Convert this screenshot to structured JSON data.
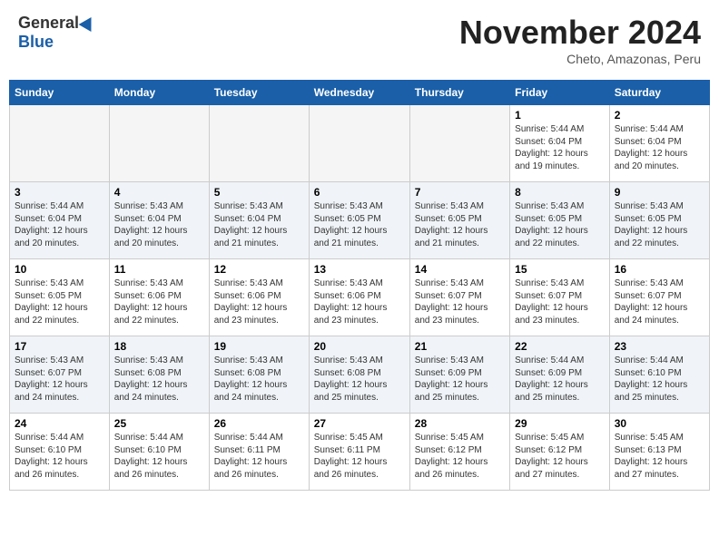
{
  "header": {
    "logo": {
      "general": "General",
      "blue": "Blue"
    },
    "title": "November 2024",
    "location": "Cheto, Amazonas, Peru"
  },
  "calendar": {
    "days_of_week": [
      "Sunday",
      "Monday",
      "Tuesday",
      "Wednesday",
      "Thursday",
      "Friday",
      "Saturday"
    ],
    "weeks": [
      [
        {
          "day": "",
          "info": ""
        },
        {
          "day": "",
          "info": ""
        },
        {
          "day": "",
          "info": ""
        },
        {
          "day": "",
          "info": ""
        },
        {
          "day": "",
          "info": ""
        },
        {
          "day": "1",
          "info": "Sunrise: 5:44 AM\nSunset: 6:04 PM\nDaylight: 12 hours\nand 19 minutes."
        },
        {
          "day": "2",
          "info": "Sunrise: 5:44 AM\nSunset: 6:04 PM\nDaylight: 12 hours\nand 20 minutes."
        }
      ],
      [
        {
          "day": "3",
          "info": "Sunrise: 5:44 AM\nSunset: 6:04 PM\nDaylight: 12 hours\nand 20 minutes."
        },
        {
          "day": "4",
          "info": "Sunrise: 5:43 AM\nSunset: 6:04 PM\nDaylight: 12 hours\nand 20 minutes."
        },
        {
          "day": "5",
          "info": "Sunrise: 5:43 AM\nSunset: 6:04 PM\nDaylight: 12 hours\nand 21 minutes."
        },
        {
          "day": "6",
          "info": "Sunrise: 5:43 AM\nSunset: 6:05 PM\nDaylight: 12 hours\nand 21 minutes."
        },
        {
          "day": "7",
          "info": "Sunrise: 5:43 AM\nSunset: 6:05 PM\nDaylight: 12 hours\nand 21 minutes."
        },
        {
          "day": "8",
          "info": "Sunrise: 5:43 AM\nSunset: 6:05 PM\nDaylight: 12 hours\nand 22 minutes."
        },
        {
          "day": "9",
          "info": "Sunrise: 5:43 AM\nSunset: 6:05 PM\nDaylight: 12 hours\nand 22 minutes."
        }
      ],
      [
        {
          "day": "10",
          "info": "Sunrise: 5:43 AM\nSunset: 6:05 PM\nDaylight: 12 hours\nand 22 minutes."
        },
        {
          "day": "11",
          "info": "Sunrise: 5:43 AM\nSunset: 6:06 PM\nDaylight: 12 hours\nand 22 minutes."
        },
        {
          "day": "12",
          "info": "Sunrise: 5:43 AM\nSunset: 6:06 PM\nDaylight: 12 hours\nand 23 minutes."
        },
        {
          "day": "13",
          "info": "Sunrise: 5:43 AM\nSunset: 6:06 PM\nDaylight: 12 hours\nand 23 minutes."
        },
        {
          "day": "14",
          "info": "Sunrise: 5:43 AM\nSunset: 6:07 PM\nDaylight: 12 hours\nand 23 minutes."
        },
        {
          "day": "15",
          "info": "Sunrise: 5:43 AM\nSunset: 6:07 PM\nDaylight: 12 hours\nand 23 minutes."
        },
        {
          "day": "16",
          "info": "Sunrise: 5:43 AM\nSunset: 6:07 PM\nDaylight: 12 hours\nand 24 minutes."
        }
      ],
      [
        {
          "day": "17",
          "info": "Sunrise: 5:43 AM\nSunset: 6:07 PM\nDaylight: 12 hours\nand 24 minutes."
        },
        {
          "day": "18",
          "info": "Sunrise: 5:43 AM\nSunset: 6:08 PM\nDaylight: 12 hours\nand 24 minutes."
        },
        {
          "day": "19",
          "info": "Sunrise: 5:43 AM\nSunset: 6:08 PM\nDaylight: 12 hours\nand 24 minutes."
        },
        {
          "day": "20",
          "info": "Sunrise: 5:43 AM\nSunset: 6:08 PM\nDaylight: 12 hours\nand 25 minutes."
        },
        {
          "day": "21",
          "info": "Sunrise: 5:43 AM\nSunset: 6:09 PM\nDaylight: 12 hours\nand 25 minutes."
        },
        {
          "day": "22",
          "info": "Sunrise: 5:44 AM\nSunset: 6:09 PM\nDaylight: 12 hours\nand 25 minutes."
        },
        {
          "day": "23",
          "info": "Sunrise: 5:44 AM\nSunset: 6:10 PM\nDaylight: 12 hours\nand 25 minutes."
        }
      ],
      [
        {
          "day": "24",
          "info": "Sunrise: 5:44 AM\nSunset: 6:10 PM\nDaylight: 12 hours\nand 26 minutes."
        },
        {
          "day": "25",
          "info": "Sunrise: 5:44 AM\nSunset: 6:10 PM\nDaylight: 12 hours\nand 26 minutes."
        },
        {
          "day": "26",
          "info": "Sunrise: 5:44 AM\nSunset: 6:11 PM\nDaylight: 12 hours\nand 26 minutes."
        },
        {
          "day": "27",
          "info": "Sunrise: 5:45 AM\nSunset: 6:11 PM\nDaylight: 12 hours\nand 26 minutes."
        },
        {
          "day": "28",
          "info": "Sunrise: 5:45 AM\nSunset: 6:12 PM\nDaylight: 12 hours\nand 26 minutes."
        },
        {
          "day": "29",
          "info": "Sunrise: 5:45 AM\nSunset: 6:12 PM\nDaylight: 12 hours\nand 27 minutes."
        },
        {
          "day": "30",
          "info": "Sunrise: 5:45 AM\nSunset: 6:13 PM\nDaylight: 12 hours\nand 27 minutes."
        }
      ]
    ]
  }
}
